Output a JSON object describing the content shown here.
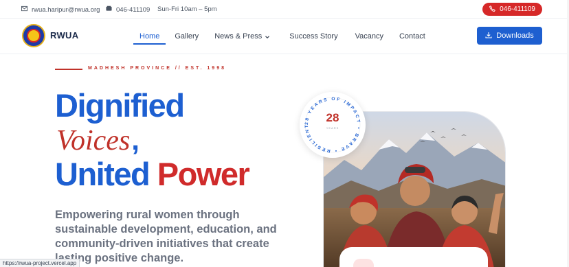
{
  "topbar": {
    "email": "rwua.haripur@rwua.org",
    "phone": "046-411109",
    "hours": "Sun-Fri 10am – 5pm",
    "call_button": "046-411109"
  },
  "nav": {
    "brand": "RWUA",
    "links": [
      {
        "label": "Home",
        "active": true
      },
      {
        "label": "Gallery"
      },
      {
        "label": "News & Press"
      },
      {
        "label": "Success Story"
      },
      {
        "label": "Vacancy"
      },
      {
        "label": "Contact"
      }
    ],
    "downloads_label": "Downloads"
  },
  "hero": {
    "eyebrow": "MADHESH PROVINCE // EST. 1998",
    "line1": "Dignified",
    "line2_italic": "Voices",
    "line2_comma": ",",
    "line3_blue": "United",
    "line3_red": "Power",
    "subtitle": "Empowering rural women through sustainable development, education, and community-driven initiatives that create lasting positive change."
  },
  "badge": {
    "number": "28",
    "small": "YEARS",
    "ring_text": "28 YEARS OF IMPACT • BRAVE • RESILIENT •"
  },
  "status_url": "https://rwua-project.vercel.app",
  "colors": {
    "primary_blue": "#1d5fd1",
    "accent_red": "#c0322a"
  },
  "icons": {
    "email": "mail-icon",
    "phone": "phone-icon",
    "downloads": "download-icon"
  }
}
